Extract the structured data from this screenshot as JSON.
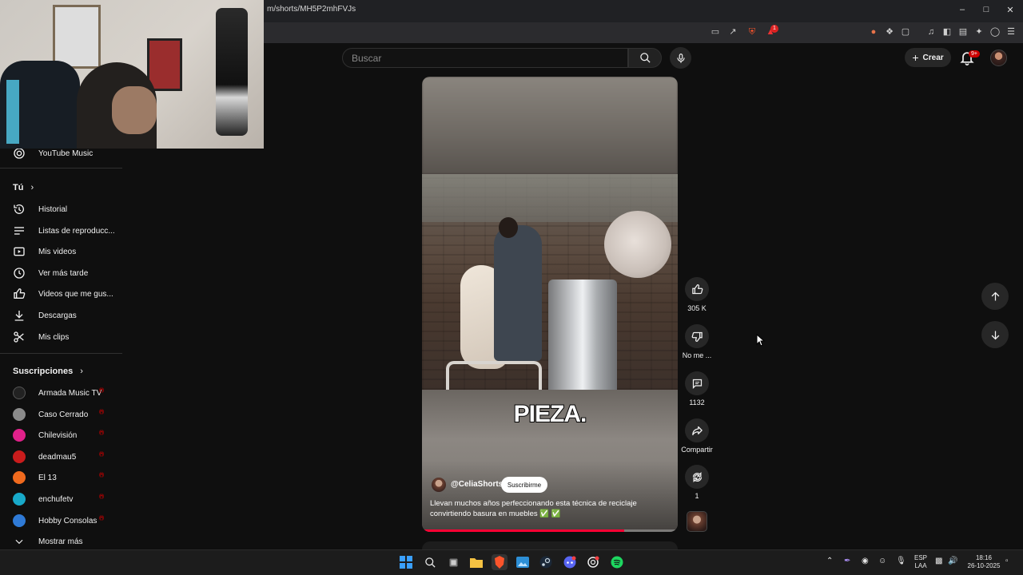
{
  "browser": {
    "url": "m/shorts/MH5P2mhFVJs",
    "notification_badge": "1"
  },
  "header": {
    "search_placeholder": "Buscar",
    "create_label": "Crear",
    "notif_badge": "9+"
  },
  "sidebar": {
    "top_items": [
      {
        "label": "YouTube Music",
        "icon": "youtube-music-icon"
      }
    ],
    "you_section": "Tú",
    "you_items": [
      {
        "label": "Historial",
        "icon": "history-icon"
      },
      {
        "label": "Listas de reproducc...",
        "icon": "playlist-icon"
      },
      {
        "label": "Mis videos",
        "icon": "your-videos-icon"
      },
      {
        "label": "Ver más tarde",
        "icon": "watch-later-icon"
      },
      {
        "label": "Videos que me gus...",
        "icon": "liked-icon"
      },
      {
        "label": "Descargas",
        "icon": "download-icon"
      },
      {
        "label": "Mis clips",
        "icon": "scissors-icon"
      }
    ],
    "subs_section": "Suscripciones",
    "subscriptions": [
      {
        "label": "Armada Music TV",
        "color": "#222222"
      },
      {
        "label": "Caso Cerrado",
        "color": "#8b8b8b"
      },
      {
        "label": "Chilevisión",
        "color": "#e0218a"
      },
      {
        "label": "deadmau5",
        "color": "#c91c1c"
      },
      {
        "label": "El 13",
        "color": "#f06a1e"
      },
      {
        "label": "enchufetv",
        "color": "#18a9c9"
      },
      {
        "label": "Hobby Consolas",
        "color": "#2f7ad6"
      }
    ],
    "show_more": "Mostrar más"
  },
  "short": {
    "caption": "PIEZA.",
    "channel": "@CeliaShorts",
    "subscribe": "Suscribirme",
    "description": "Llevan muchos años perfeccionando esta técnica de reciclaje convirtiendo basura en muebles ✅ ✅",
    "progress_fraction": 0.79
  },
  "actions": {
    "likes": "305 K",
    "dislike": "No me ...",
    "comments": "1132",
    "share": "Compartir",
    "remix": "1"
  },
  "tray": {
    "lang_line1": "ESP",
    "lang_line2": "LAA",
    "time": "18:16",
    "date": "26-10-2025"
  },
  "colors": {
    "accent_red": "#ff0033",
    "background": "#0f0f0f",
    "surface": "#272727"
  }
}
